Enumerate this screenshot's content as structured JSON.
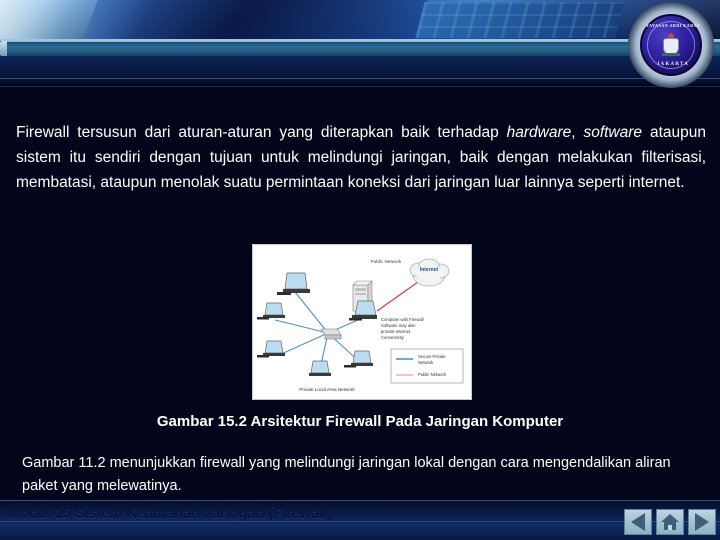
{
  "header": {
    "banner_alt": "blue keyboard technology banner",
    "logo": {
      "top_text": "YAYASAN ARDI KARYA",
      "bottom_text": "JAKARTA"
    }
  },
  "body": {
    "paragraph_part1": "Firewall tersusun dari aturan-aturan yang diterapkan baik terhadap ",
    "paragraph_em1": "hardware",
    "paragraph_part2": ", ",
    "paragraph_em2": "software",
    "paragraph_part3": " ataupun sistem itu sendiri dengan tujuan untuk melindungi jaringan, baik dengan melakukan filterisasi, membatasi, ataupun menolak suatu permintaan koneksi dari jaringan luar lainnya seperti internet."
  },
  "figure": {
    "caption": "Gambar 15.2 Arsitektur Firewall Pada Jaringan Komputer",
    "labels": {
      "internet": "Internet",
      "public_network": "Public Network",
      "firewall_computer": "Computer with Firewall Software may also provide Internet Connectivity",
      "lan": "Private Local Area Network"
    },
    "legend": [
      {
        "label": "Secure Private Network",
        "color": "#3b8fc4"
      },
      {
        "label": "Public Network",
        "color": "#e08a8a"
      }
    ]
  },
  "lower": {
    "paragraph": "Gambar 11.2 menunjukkan firewall yang melindungi jaringan lokal dengan cara mengendalikan aliran paket yang melewatinya."
  },
  "footer": {
    "text": "Modul 15 Sistem Keamanan Jaringan (Firewall)",
    "nav": {
      "back_label": "Back",
      "home_label": "Home",
      "next_label": "Next"
    }
  },
  "colors": {
    "background": "#03061a",
    "text": "#ffffff",
    "banner_blue": "#1d59ab",
    "band_teal": "#2a6b96",
    "footer_text": "#0a1340"
  }
}
